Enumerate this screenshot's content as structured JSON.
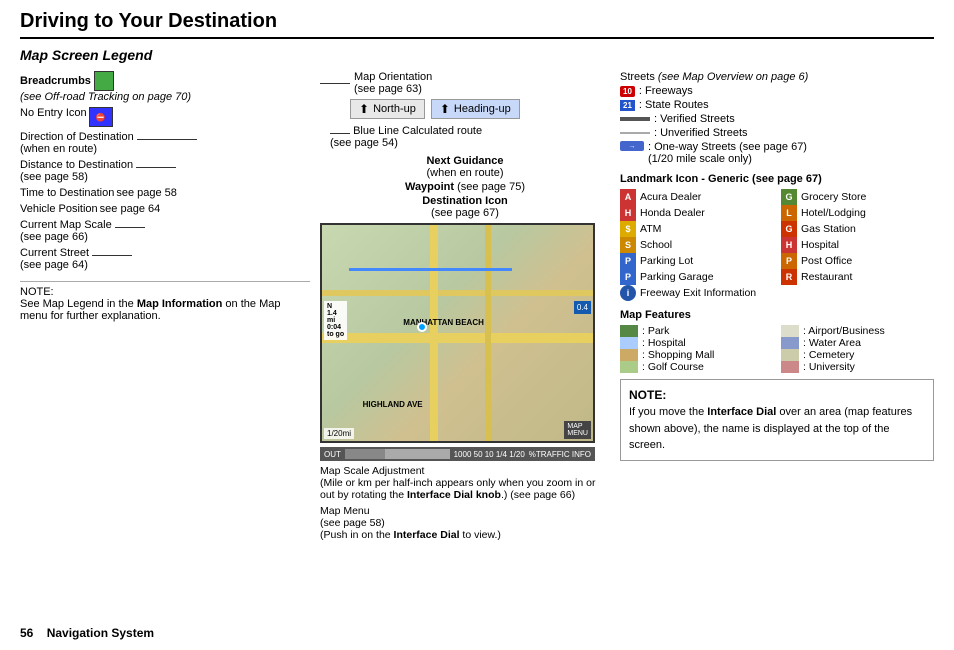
{
  "page": {
    "title": "Driving to Your Destination",
    "section": "Map Screen Legend",
    "page_number": "56",
    "page_label": "Navigation System"
  },
  "left_panel": {
    "breadcrumbs": {
      "label": "Breadcrumbs",
      "sub": "(see Off-road Tracking on page 70)"
    },
    "no_entry": {
      "label": "No Entry Icon"
    },
    "direction": {
      "label": "Direction of Destination",
      "sub": "(when en route)"
    },
    "distance": {
      "label": "Distance to Destination",
      "sub": "(see page 58)"
    },
    "time": {
      "label": "Time to Destination",
      "sub": "see page 58"
    },
    "vehicle_pos": {
      "label": "Vehicle Position",
      "sub": "see page 64"
    },
    "map_scale": {
      "label": "Current Map Scale",
      "sub": "(see page 66)"
    },
    "current_street": {
      "label": "Current Street",
      "sub": "(see page 64)"
    }
  },
  "center_panel": {
    "map_orientation": {
      "label": "Map Orientation",
      "sub": "(see page 63)",
      "btn_north": "North-up",
      "btn_heading": "Heading-up"
    },
    "blue_line": {
      "label": "Blue Line",
      "desc": "Calculated route",
      "sub": "(see page 54)"
    },
    "next_guidance": {
      "label": "Next Guidance",
      "sub": "(when en route)"
    },
    "waypoint": {
      "label": "Waypoint",
      "sub": "(see page 75)"
    },
    "destination_icon": {
      "label": "Destination Icon",
      "sub": "(see page 67)"
    },
    "map_scale_adj": {
      "label": "Map Scale Adjustment",
      "desc": "(Mile or km per half-inch appears only when you zoom in or out by rotating the",
      "bold_part": "Interface Dial knob",
      "end": ".) (see page 66)"
    },
    "map_menu": {
      "label": "Map Menu",
      "sub": "(see page 58)",
      "desc": "(Push in on the",
      "bold_part": "Interface Dial",
      "end": "to view.)"
    }
  },
  "right_panel": {
    "streets": {
      "title": "Streets",
      "sub": "(see Map Overview on page 6)",
      "items": [
        {
          "type": "freeway",
          "badge": "10",
          "label": ": Freeways"
        },
        {
          "type": "state",
          "badge": "21",
          "label": ": State Routes"
        },
        {
          "type": "verified",
          "label": ": Verified Streets"
        },
        {
          "type": "unverified",
          "label": ": Unverified Streets"
        },
        {
          "type": "oneway",
          "label": ": One-way Streets (see page 67) (1/20 mile scale only)"
        }
      ]
    },
    "landmark": {
      "title": "Landmark Icon - Generic",
      "sub": "(see page 67)",
      "items_col1": [
        {
          "icon_color": "#cc3333",
          "icon_letter": "A",
          "label": "Acura Dealer"
        },
        {
          "icon_color": "#cc3333",
          "icon_letter": "H",
          "label": "Honda Dealer"
        },
        {
          "icon_color": "#ddaa00",
          "icon_letter": "$",
          "label": "ATM"
        },
        {
          "icon_color": "#cc8800",
          "icon_letter": "S",
          "label": "School"
        },
        {
          "icon_color": "#3366cc",
          "icon_letter": "P",
          "label": "Parking Lot"
        },
        {
          "icon_color": "#3366cc",
          "icon_letter": "P",
          "label": "Parking Garage"
        },
        {
          "icon_color": "#2244aa",
          "icon_letter": "i",
          "label": "Freeway Exit Information"
        }
      ],
      "items_col2": [
        {
          "icon_color": "#558833",
          "icon_letter": "G",
          "label": "Grocery Store"
        },
        {
          "icon_color": "#cc6600",
          "icon_letter": "L",
          "label": "Hotel/Lodging"
        },
        {
          "icon_color": "#cc3300",
          "icon_letter": "G",
          "label": "Gas Station"
        },
        {
          "icon_color": "#cc3333",
          "icon_letter": "H",
          "label": "Hospital"
        },
        {
          "icon_color": "#cc6600",
          "icon_letter": "P",
          "label": "Post Office"
        },
        {
          "icon_color": "#cc3300",
          "icon_letter": "R",
          "label": "Restaurant"
        }
      ]
    },
    "map_features": {
      "title": "Map Features",
      "items": [
        {
          "color": "#558844",
          "label": ": Park",
          "col": 1
        },
        {
          "color": "#aaccff",
          "label": ": Hospital",
          "col": 1
        },
        {
          "color": "#ccaa66",
          "label": ": Shopping Mall",
          "col": 1
        },
        {
          "color": "#aacc88",
          "label": ": Golf Course",
          "col": 1
        },
        {
          "color": "#ddddcc",
          "label": ": Airport/Business",
          "col": 2
        },
        {
          "color": "#8899cc",
          "label": ": Water Area",
          "col": 2
        },
        {
          "color": "#ccccaa",
          "label": ": Cemetery",
          "col": 2
        },
        {
          "color": "#cc8888",
          "label": ": University",
          "col": 2
        }
      ]
    },
    "note": {
      "title": "NOTE:",
      "text1": "If you move the ",
      "bold1": "Interface Dial",
      "text2": " over an area (map features shown above), the name is displayed at the top of the screen."
    }
  },
  "bottom_note": {
    "title": "NOTE:",
    "text": "See Map Legend in the ",
    "bold": "Map Information",
    "end": " on the Map menu for further explanation."
  }
}
